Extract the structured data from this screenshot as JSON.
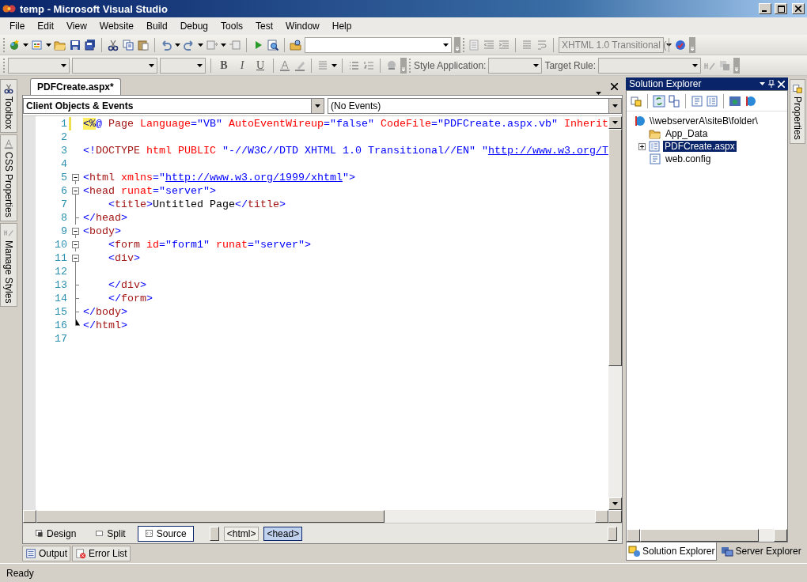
{
  "window": {
    "title": "temp - Microsoft Visual Studio"
  },
  "menu": [
    "File",
    "Edit",
    "View",
    "Website",
    "Build",
    "Debug",
    "Tools",
    "Test",
    "Window",
    "Help"
  ],
  "standard_toolbar": {
    "doctype_combo": {
      "value": "XHTML 1.0 Transitional (",
      "disabled": true
    }
  },
  "formatting_toolbar": {
    "format_buttons": [
      "B",
      "I",
      "U"
    ],
    "style_application_label": "Style Application:",
    "target_rule_label": "Target Rule:"
  },
  "left_tabs": [
    "Toolbox",
    "CSS Properties",
    "Manage Styles"
  ],
  "document_tabs": [
    {
      "label": "PDFCreate.aspx*",
      "selected": true
    }
  ],
  "editor": {
    "object_dropdown": "Client Objects & Events",
    "event_dropdown": "(No Events)",
    "lines": [
      {
        "number": "1",
        "kind": "none",
        "modified": true,
        "tokens": [
          {
            "kind": "hl",
            "text": "<%"
          },
          {
            "kind": "punct",
            "text": "@"
          },
          {
            "kind": "tag",
            "text": " Page"
          },
          {
            "kind": "attr",
            "text": " Language"
          },
          {
            "kind": "value",
            "text": "=\"VB\""
          },
          {
            "kind": "attr",
            "text": " AutoEventWireup"
          },
          {
            "kind": "value",
            "text": "=\"false\""
          },
          {
            "kind": "attr",
            "text": " CodeFile"
          },
          {
            "kind": "value",
            "text": "=\"PDFCreate.aspx.vb\""
          },
          {
            "kind": "attr",
            "text": " Inherit"
          }
        ]
      },
      {
        "number": "2",
        "kind": "none",
        "modified": false
      },
      {
        "number": "3",
        "kind": "none",
        "modified": false,
        "tokens": [
          {
            "kind": "punct",
            "text": "<!"
          },
          {
            "kind": "tag",
            "text": "DOCTYPE"
          },
          {
            "kind": "attr",
            "text": " html PUBLIC"
          },
          {
            "kind": "value",
            "text": " \"-//W3C//DTD XHTML 1.0 Transitional//EN\" \""
          },
          {
            "kind": "link",
            "text": "http://www.w3.org/T"
          }
        ]
      },
      {
        "number": "4",
        "kind": "none",
        "modified": false
      },
      {
        "number": "5",
        "kind": "box",
        "modified": false,
        "tokens": [
          {
            "kind": "punct",
            "text": "<"
          },
          {
            "kind": "tag",
            "text": "html"
          },
          {
            "kind": "attr",
            "text": " xmlns"
          },
          {
            "kind": "value",
            "text": "=\""
          },
          {
            "kind": "link",
            "text": "http://www.w3.org/1999/xhtml"
          },
          {
            "kind": "value",
            "text": "\">"
          }
        ]
      },
      {
        "number": "6",
        "kind": "box",
        "modified": false,
        "tokens": [
          {
            "kind": "punct",
            "text": "<"
          },
          {
            "kind": "tag",
            "text": "head"
          },
          {
            "kind": "attr",
            "text": " runat"
          },
          {
            "kind": "value",
            "text": "=\"server\">"
          }
        ]
      },
      {
        "number": "7",
        "kind": "bar",
        "modified": false,
        "tokens": [
          {
            "kind": "punct",
            "text": "    <"
          },
          {
            "kind": "tag",
            "text": "title"
          },
          {
            "kind": "punct",
            "text": ">"
          },
          {
            "kind": "text",
            "text": "Untitled Page"
          },
          {
            "kind": "punct",
            "text": "</"
          },
          {
            "kind": "tag",
            "text": "title"
          },
          {
            "kind": "punct",
            "text": ">"
          }
        ]
      },
      {
        "number": "8",
        "kind": "tee",
        "modified": false,
        "tokens": [
          {
            "kind": "punct",
            "text": "</"
          },
          {
            "kind": "tag",
            "text": "head"
          },
          {
            "kind": "punct",
            "text": ">"
          }
        ]
      },
      {
        "number": "9",
        "kind": "box",
        "modified": false,
        "tokens": [
          {
            "kind": "punct",
            "text": "<"
          },
          {
            "kind": "tag",
            "text": "body"
          },
          {
            "kind": "punct",
            "text": ">"
          }
        ]
      },
      {
        "number": "10",
        "kind": "box",
        "modified": false,
        "tokens": [
          {
            "kind": "punct",
            "text": "    <"
          },
          {
            "kind": "tag",
            "text": "form"
          },
          {
            "kind": "attr",
            "text": " id"
          },
          {
            "kind": "value",
            "text": "=\"form1\""
          },
          {
            "kind": "attr",
            "text": " runat"
          },
          {
            "kind": "value",
            "text": "=\"server\">"
          }
        ]
      },
      {
        "number": "11",
        "kind": "box",
        "modified": false,
        "tokens": [
          {
            "kind": "punct",
            "text": "    <"
          },
          {
            "kind": "tag",
            "text": "div"
          },
          {
            "kind": "punct",
            "text": ">"
          }
        ]
      },
      {
        "number": "12",
        "kind": "bar",
        "modified": false
      },
      {
        "number": "13",
        "kind": "tee",
        "modified": false,
        "tokens": [
          {
            "kind": "punct",
            "text": "    </"
          },
          {
            "kind": "tag",
            "text": "div"
          },
          {
            "kind": "punct",
            "text": ">"
          }
        ]
      },
      {
        "number": "14",
        "kind": "tee",
        "modified": false,
        "tokens": [
          {
            "kind": "punct",
            "text": "    </"
          },
          {
            "kind": "tag",
            "text": "form"
          },
          {
            "kind": "punct",
            "text": ">"
          }
        ]
      },
      {
        "number": "15",
        "kind": "tee",
        "modified": false,
        "tokens": [
          {
            "kind": "punct",
            "text": "</"
          },
          {
            "kind": "tag",
            "text": "body"
          },
          {
            "kind": "punct",
            "text": ">"
          }
        ]
      },
      {
        "number": "16",
        "kind": "corner",
        "modified": false,
        "tokens": [
          {
            "kind": "punct",
            "text": "</"
          },
          {
            "kind": "tag",
            "text": "html"
          },
          {
            "kind": "punct",
            "text": ">"
          }
        ]
      },
      {
        "number": "17",
        "kind": "none",
        "modified": false
      }
    ],
    "view_tabs": [
      {
        "label": "Design",
        "selected": false
      },
      {
        "label": "Split",
        "selected": false
      },
      {
        "label": "Source",
        "selected": true
      }
    ],
    "tag_path": [
      {
        "label": "<html>",
        "selected": false
      },
      {
        "label": "<head>",
        "selected": true
      }
    ]
  },
  "solution_explorer": {
    "title": "Solution Explorer",
    "tree": [
      {
        "label": "\\\\webserverA\\siteB\\folder\\",
        "kind": "site",
        "selected": false,
        "expanded": true,
        "children": [
          {
            "label": "App_Data",
            "kind": "folder",
            "selected": false
          },
          {
            "label": "PDFCreate.aspx",
            "kind": "page",
            "selected": true,
            "expanded": false
          },
          {
            "label": "web.config",
            "kind": "config",
            "selected": false
          }
        ]
      }
    ],
    "bottom_tabs": [
      {
        "label": "Solution Explorer",
        "selected": true
      },
      {
        "label": "Server Explorer",
        "selected": false
      }
    ]
  },
  "right_tabs": [
    "Properties"
  ],
  "output_tabs": [
    {
      "label": "Output",
      "kind": "output"
    },
    {
      "label": "Error List",
      "kind": "errors"
    }
  ],
  "status_bar": "Ready"
}
